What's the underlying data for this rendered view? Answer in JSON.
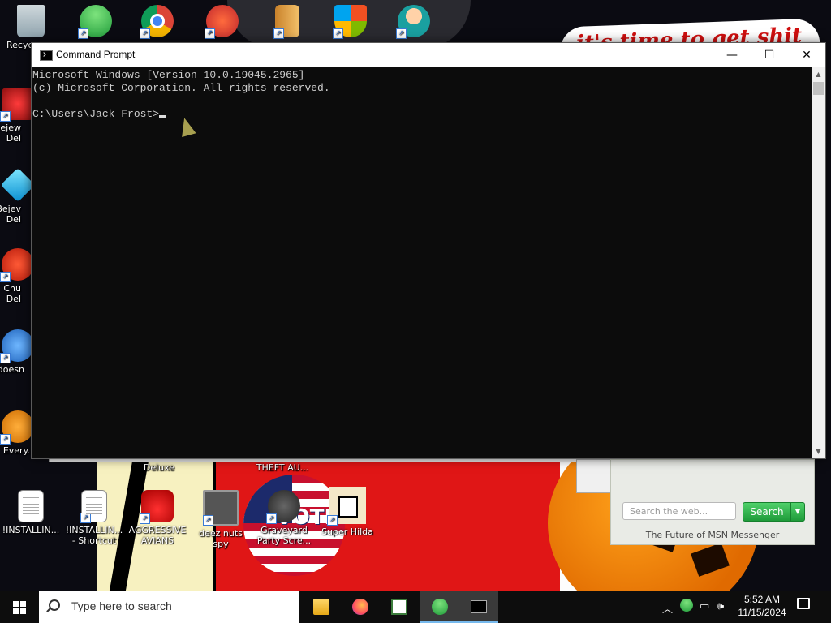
{
  "desktop": {
    "banner_text": "it's time to get shit",
    "flag_text": "VOTE",
    "icons_left": [
      {
        "label": "Recyc"
      },
      {
        "label": "Bejew Del"
      },
      {
        "label": "Bejev Del"
      },
      {
        "label": "Chu Del"
      },
      {
        "label": "doesn"
      },
      {
        "label": "Every..."
      }
    ],
    "icons_bottom": [
      {
        "label": "!INSTALLIN..."
      },
      {
        "label": "!INSTALLIN... - Shortcut"
      },
      {
        "label": "AGGRESSIVE AVIANS"
      },
      {
        "label": "deez nuts spy"
      },
      {
        "label": "Graveyard Party Scre..."
      },
      {
        "label": "Super Hilda"
      }
    ],
    "partial_labels": {
      "deluxe": "Deluxe",
      "theft": "THEFT AU..."
    }
  },
  "cmd": {
    "title": "Command Prompt",
    "line1": "Microsoft Windows [Version 10.0.19045.2965]",
    "line2": "(c) Microsoft Corporation. All rights reserved.",
    "prompt": "C:\\Users\\Jack Frost>"
  },
  "msn": {
    "search_placeholder": "Search the web...",
    "search_button": "Search",
    "footer": "The Future of MSN Messenger"
  },
  "taskbar": {
    "search_placeholder": "Type here to search",
    "time": "5:52 AM",
    "date": "11/15/2024"
  }
}
